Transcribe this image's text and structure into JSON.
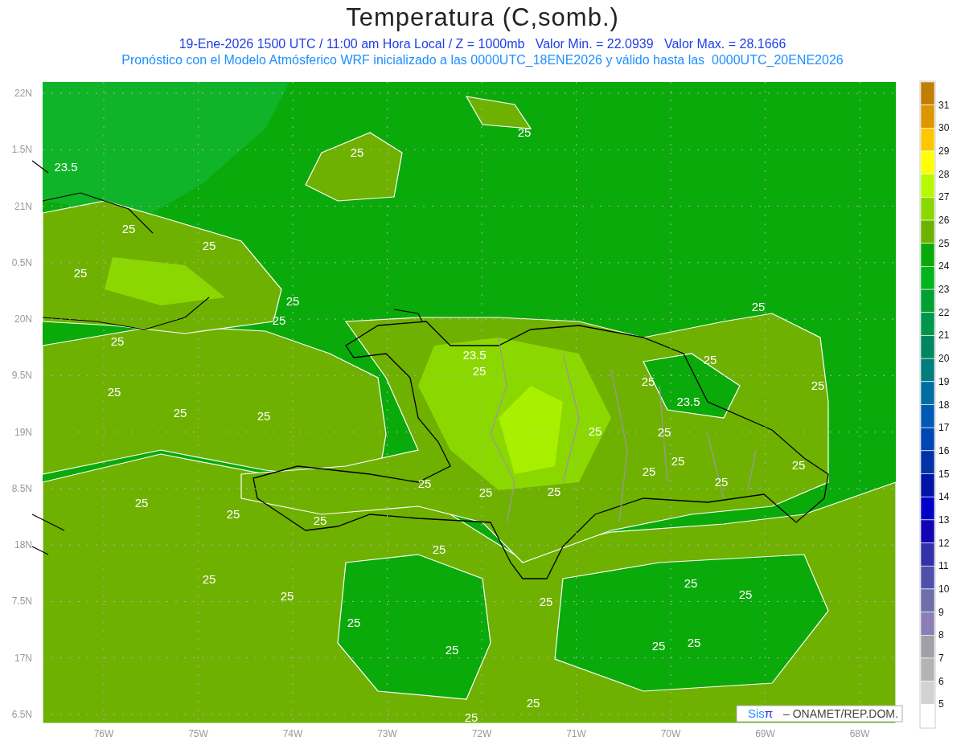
{
  "title": "Temperatura (C,somb.)",
  "subtitle": "19-Ene-2026 1500 UTC / 11:00 am Hora Local / Z = 1000mb   Valor Min. = 22.0939   Valor Max. = 28.1666",
  "description": "Pronóstico con el Modelo Atmósferico WRF inicializado a las 0000UTC_18ENE2026 y válido hasta las  0000UTC_20ENE2026",
  "y_ticks": [
    "22N",
    "1.5N",
    "21N",
    "0.5N",
    "20N",
    "9.5N",
    "19N",
    "8.5N",
    "18N",
    "7.5N",
    "17N",
    "6.5N"
  ],
  "x_ticks": [
    "76W",
    "75W",
    "74W",
    "73W",
    "72W",
    "71W",
    "70W",
    "69W",
    "68W"
  ],
  "contour_labels": [
    "23.5",
    "25",
    "25",
    "25",
    "25",
    "25",
    "25",
    "25",
    "25",
    "25",
    "25",
    "23.5",
    "25",
    "25",
    "23.5",
    "25",
    "25",
    "25",
    "25",
    "25",
    "25",
    "25",
    "25",
    "25",
    "25",
    "25",
    "25",
    "25",
    "25",
    "25",
    "25",
    "25",
    "25",
    "25",
    "25",
    "25",
    "25",
    "25",
    "25",
    "25",
    "25",
    "25",
    "25"
  ],
  "credit": {
    "brand": [
      "Sis",
      "π"
    ],
    "text": "– ONAMET/REP.DOM."
  },
  "colorbar": {
    "steps": [
      {
        "color": "#c07f00"
      },
      {
        "label": "31",
        "color": "#de9600"
      },
      {
        "label": "30",
        "color": "#ffc700"
      },
      {
        "label": "29",
        "color": "#ffff00"
      },
      {
        "label": "28",
        "color": "#b5fa00"
      },
      {
        "label": "27",
        "color": "#8bd800"
      },
      {
        "label": "26",
        "color": "#6fb100"
      },
      {
        "label": "25",
        "color": "#0aaa0a"
      },
      {
        "label": "24",
        "color": "#00b41e"
      },
      {
        "label": "23",
        "color": "#00a032"
      },
      {
        "label": "22",
        "color": "#00964b"
      },
      {
        "label": "21",
        "color": "#00875f"
      },
      {
        "label": "20",
        "color": "#007d7d"
      },
      {
        "label": "19",
        "color": "#006ea0"
      },
      {
        "label": "18",
        "color": "#005ab4"
      },
      {
        "label": "17",
        "color": "#0046b4"
      },
      {
        "label": "16",
        "color": "#0032aa"
      },
      {
        "label": "15",
        "color": "#0014a5"
      },
      {
        "label": "14",
        "color": "#0000c8"
      },
      {
        "label": "13",
        "color": "#1405b4"
      },
      {
        "label": "12",
        "color": "#3232aa"
      },
      {
        "label": "11",
        "color": "#5050aa"
      },
      {
        "label": "10",
        "color": "#6e6eaa"
      },
      {
        "label": "9",
        "color": "#8c7db4"
      },
      {
        "label": "8",
        "color": "#a0a0aa"
      },
      {
        "label": "7",
        "color": "#b4b4b4"
      },
      {
        "label": "6",
        "color": "#d2d2d2"
      },
      {
        "label": "5",
        "color": "#ffffff"
      }
    ]
  }
}
